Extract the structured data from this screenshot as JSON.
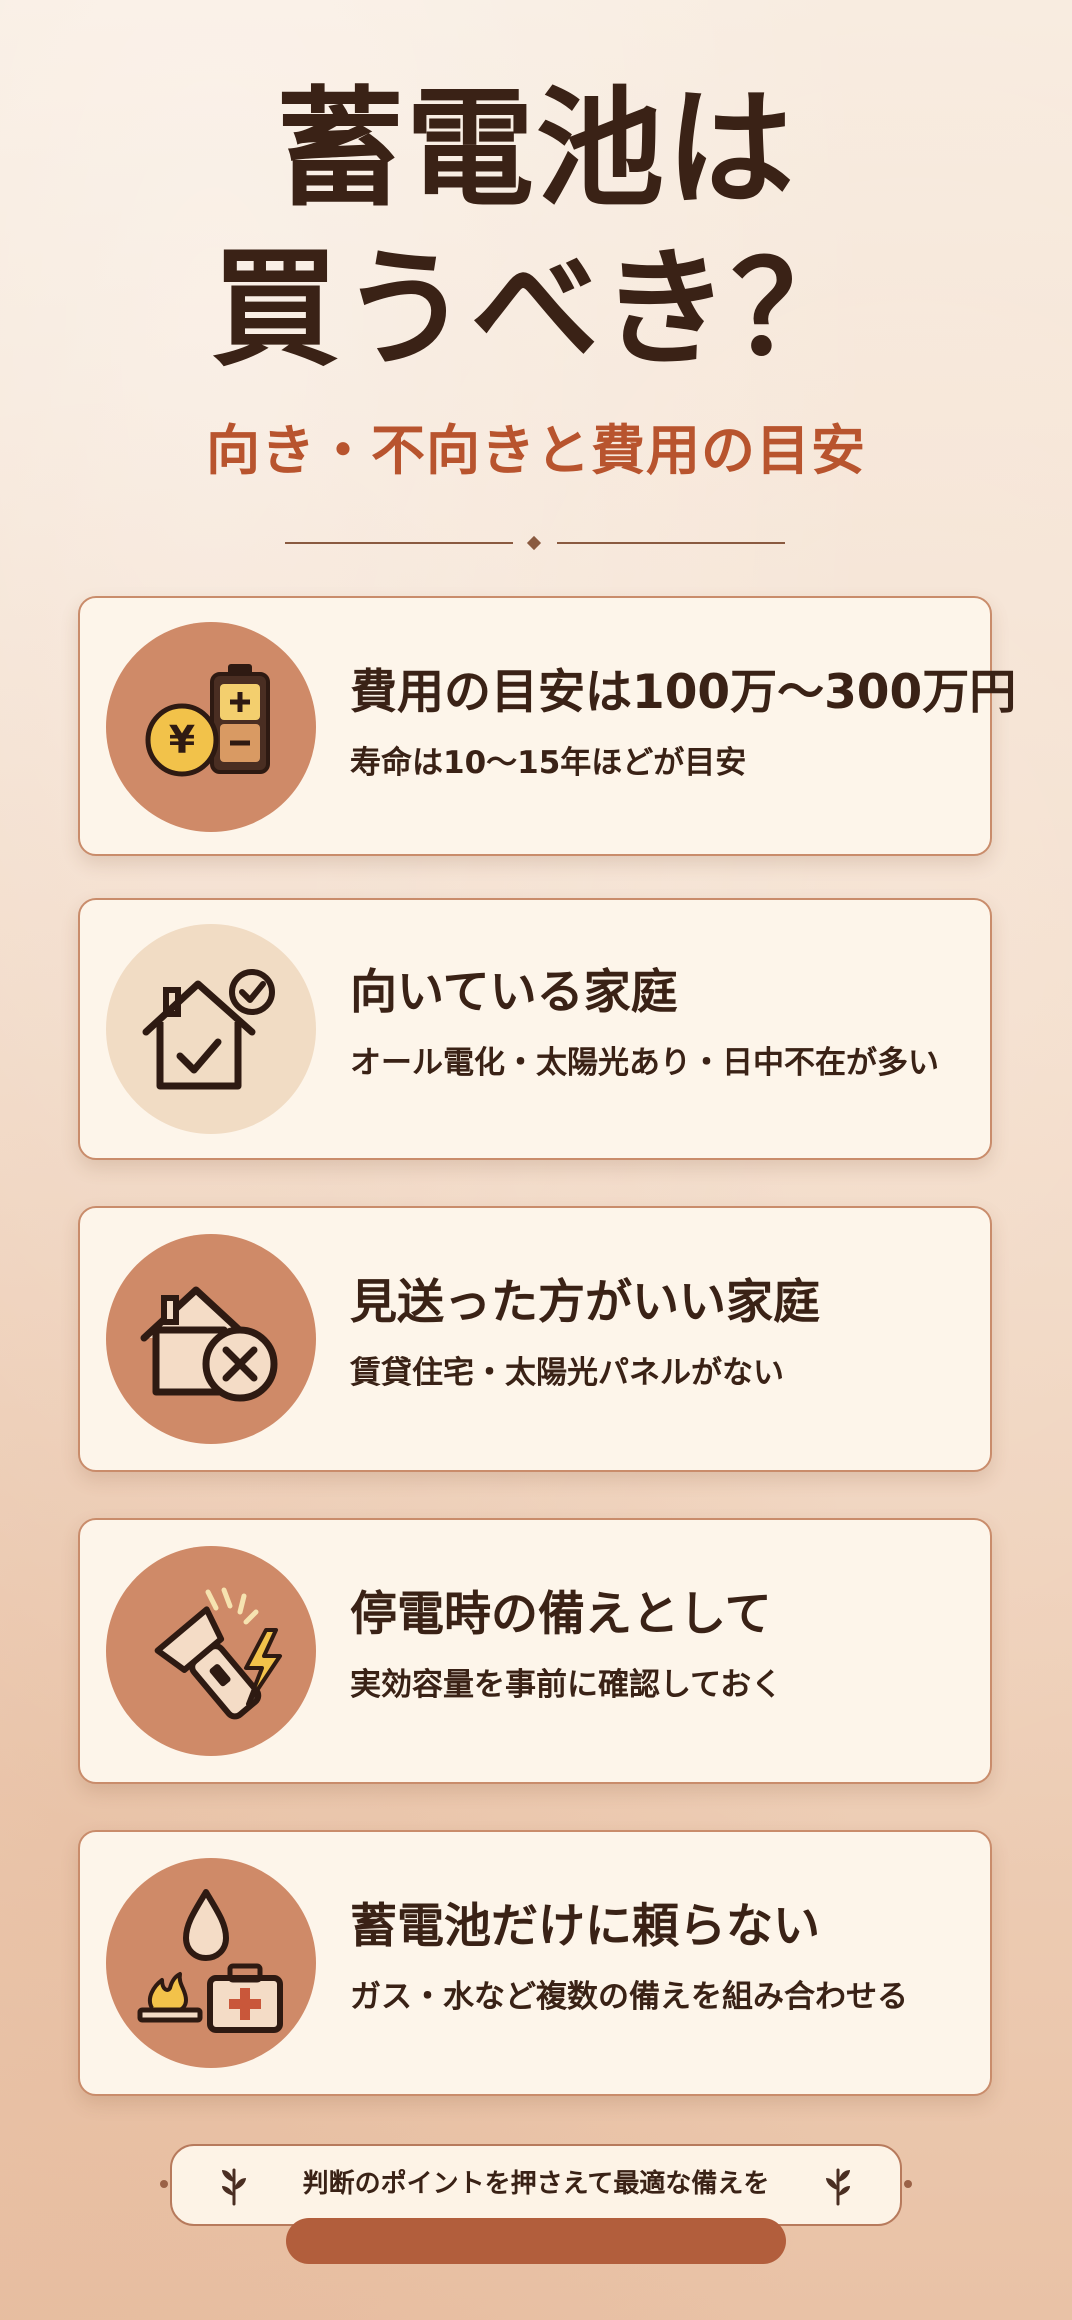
{
  "header": {
    "title_line1": "蓄電池は",
    "title_line2": "買うべき？",
    "subtitle": "向き・不向きと費用の目安"
  },
  "cards": [
    {
      "title": "費用の目安は100万〜300万円",
      "desc": "寿命は10〜15年ほどが目安",
      "icon": "yen-coin-battery-icon"
    },
    {
      "title": "向いている家庭",
      "desc": "オール電化・太陽光あり・日中不在が多い",
      "icon": "house-check-icon"
    },
    {
      "title": "見送った方がいい家庭",
      "desc": "賃貸住宅・太陽光パネルがない",
      "icon": "house-cross-icon"
    },
    {
      "title": "停電時の備えとして",
      "desc": "実効容量を事前に確認しておく",
      "icon": "flashlight-lightning-icon"
    },
    {
      "title": "蓄電池だけに頼らない",
      "desc": "ガス・水など複数の備えを組み合わせる",
      "icon": "water-stove-firstaid-icon"
    }
  ],
  "footer": {
    "text": "判断のポイントを押さえて最適な備えを"
  },
  "colors": {
    "accent": "#b8542e",
    "text": "#3a2216",
    "card_bg": "#fdf5ea",
    "icon_circle": "#cf8a68",
    "icon_circle_light": "#f1dcc4"
  }
}
